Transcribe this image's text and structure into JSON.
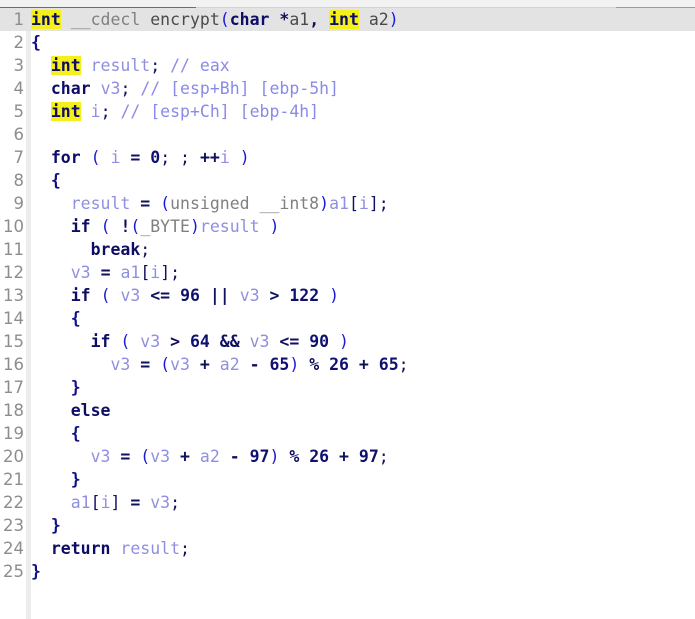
{
  "view": {
    "name": "pseudocode-view",
    "background": "#ffffff",
    "current_line_background": "#e3e3e3",
    "gutter_rule_color": "#ececec",
    "highlight_color": "#f5ef1b",
    "colors": {
      "keyword": "#0d0d66",
      "type": "#808080",
      "variable": "#8f8fe0",
      "number": "#10106e",
      "comment": "#8a8ae8",
      "paren": "#1a1ad6",
      "lineno": "#8d8d8d"
    }
  },
  "code": {
    "language": "c-pseudocode",
    "function_name": "encrypt",
    "total_lines": 25,
    "current_line": 1,
    "lines": [
      {
        "n": "1",
        "current": true,
        "tokens": [
          {
            "t": "int",
            "c": "kwhl"
          },
          {
            "t": " ",
            "c": "punct"
          },
          {
            "t": "__cdecl",
            "c": "type"
          },
          {
            "t": " ",
            "c": "punct"
          },
          {
            "t": "encrypt",
            "c": "func"
          },
          {
            "t": "(",
            "c": "paren"
          },
          {
            "t": "char",
            "c": "kw"
          },
          {
            "t": " *",
            "c": "op"
          },
          {
            "t": "a1",
            "c": "func"
          },
          {
            "t": ", ",
            "c": "op"
          },
          {
            "t": "int",
            "c": "kwhl"
          },
          {
            "t": " ",
            "c": "punct"
          },
          {
            "t": "a2",
            "c": "func"
          },
          {
            "t": ")",
            "c": "paren"
          }
        ]
      },
      {
        "n": "2",
        "current": false,
        "tokens": [
          {
            "t": "{",
            "c": "brace"
          }
        ]
      },
      {
        "n": "3",
        "current": false,
        "tokens": [
          {
            "t": "  ",
            "c": "punct"
          },
          {
            "t": "int",
            "c": "kwhl"
          },
          {
            "t": " ",
            "c": "punct"
          },
          {
            "t": "result",
            "c": "var"
          },
          {
            "t": "; ",
            "c": "punct"
          },
          {
            "t": "// eax",
            "c": "cmt"
          }
        ]
      },
      {
        "n": "4",
        "current": false,
        "tokens": [
          {
            "t": "  ",
            "c": "punct"
          },
          {
            "t": "char",
            "c": "kw"
          },
          {
            "t": " ",
            "c": "punct"
          },
          {
            "t": "v3",
            "c": "var"
          },
          {
            "t": "; ",
            "c": "punct"
          },
          {
            "t": "// [esp+Bh] [ebp-5h]",
            "c": "cmt"
          }
        ]
      },
      {
        "n": "5",
        "current": false,
        "tokens": [
          {
            "t": "  ",
            "c": "punct"
          },
          {
            "t": "int",
            "c": "kwhl"
          },
          {
            "t": " ",
            "c": "punct"
          },
          {
            "t": "i",
            "c": "var"
          },
          {
            "t": "; ",
            "c": "punct"
          },
          {
            "t": "// [esp+Ch] [ebp-4h]",
            "c": "cmt"
          }
        ]
      },
      {
        "n": "6",
        "current": false,
        "tokens": []
      },
      {
        "n": "7",
        "current": false,
        "tokens": [
          {
            "t": "  ",
            "c": "punct"
          },
          {
            "t": "for",
            "c": "kw"
          },
          {
            "t": " ",
            "c": "punct"
          },
          {
            "t": "(",
            "c": "paren"
          },
          {
            "t": " ",
            "c": "punct"
          },
          {
            "t": "i",
            "c": "var"
          },
          {
            "t": " ",
            "c": "punct"
          },
          {
            "t": "=",
            "c": "op"
          },
          {
            "t": " ",
            "c": "punct"
          },
          {
            "t": "0",
            "c": "num"
          },
          {
            "t": "; ; ",
            "c": "punct"
          },
          {
            "t": "++",
            "c": "op"
          },
          {
            "t": "i",
            "c": "var"
          },
          {
            "t": " ",
            "c": "punct"
          },
          {
            "t": ")",
            "c": "paren"
          }
        ]
      },
      {
        "n": "8",
        "current": false,
        "tokens": [
          {
            "t": "  ",
            "c": "punct"
          },
          {
            "t": "{",
            "c": "brace"
          }
        ]
      },
      {
        "n": "9",
        "current": false,
        "tokens": [
          {
            "t": "    ",
            "c": "punct"
          },
          {
            "t": "result",
            "c": "var"
          },
          {
            "t": " ",
            "c": "punct"
          },
          {
            "t": "=",
            "c": "op"
          },
          {
            "t": " ",
            "c": "punct"
          },
          {
            "t": "(",
            "c": "paren"
          },
          {
            "t": "unsigned __int8",
            "c": "type"
          },
          {
            "t": ")",
            "c": "paren"
          },
          {
            "t": "a1",
            "c": "var"
          },
          {
            "t": "[",
            "c": "punct"
          },
          {
            "t": "i",
            "c": "var"
          },
          {
            "t": "];",
            "c": "punct"
          }
        ]
      },
      {
        "n": "10",
        "current": false,
        "tokens": [
          {
            "t": "    ",
            "c": "punct"
          },
          {
            "t": "if",
            "c": "kw"
          },
          {
            "t": " ",
            "c": "punct"
          },
          {
            "t": "(",
            "c": "paren"
          },
          {
            "t": " ",
            "c": "punct"
          },
          {
            "t": "!",
            "c": "op"
          },
          {
            "t": "(",
            "c": "paren"
          },
          {
            "t": "_BYTE",
            "c": "type"
          },
          {
            "t": ")",
            "c": "paren"
          },
          {
            "t": "result",
            "c": "var"
          },
          {
            "t": " ",
            "c": "punct"
          },
          {
            "t": ")",
            "c": "paren"
          }
        ]
      },
      {
        "n": "11",
        "current": false,
        "tokens": [
          {
            "t": "      ",
            "c": "punct"
          },
          {
            "t": "break",
            "c": "kw"
          },
          {
            "t": ";",
            "c": "punct"
          }
        ]
      },
      {
        "n": "12",
        "current": false,
        "tokens": [
          {
            "t": "    ",
            "c": "punct"
          },
          {
            "t": "v3",
            "c": "var"
          },
          {
            "t": " ",
            "c": "punct"
          },
          {
            "t": "=",
            "c": "op"
          },
          {
            "t": " ",
            "c": "punct"
          },
          {
            "t": "a1",
            "c": "var"
          },
          {
            "t": "[",
            "c": "punct"
          },
          {
            "t": "i",
            "c": "var"
          },
          {
            "t": "];",
            "c": "punct"
          }
        ]
      },
      {
        "n": "13",
        "current": false,
        "tokens": [
          {
            "t": "    ",
            "c": "punct"
          },
          {
            "t": "if",
            "c": "kw"
          },
          {
            "t": " ",
            "c": "punct"
          },
          {
            "t": "(",
            "c": "paren"
          },
          {
            "t": " ",
            "c": "punct"
          },
          {
            "t": "v3",
            "c": "var"
          },
          {
            "t": " ",
            "c": "punct"
          },
          {
            "t": "<=",
            "c": "op"
          },
          {
            "t": " ",
            "c": "punct"
          },
          {
            "t": "96",
            "c": "num"
          },
          {
            "t": " ",
            "c": "punct"
          },
          {
            "t": "||",
            "c": "op"
          },
          {
            "t": " ",
            "c": "punct"
          },
          {
            "t": "v3",
            "c": "var"
          },
          {
            "t": " ",
            "c": "punct"
          },
          {
            "t": ">",
            "c": "op"
          },
          {
            "t": " ",
            "c": "punct"
          },
          {
            "t": "122",
            "c": "num"
          },
          {
            "t": " ",
            "c": "punct"
          },
          {
            "t": ")",
            "c": "paren"
          }
        ]
      },
      {
        "n": "14",
        "current": false,
        "tokens": [
          {
            "t": "    ",
            "c": "punct"
          },
          {
            "t": "{",
            "c": "brace"
          }
        ]
      },
      {
        "n": "15",
        "current": false,
        "tokens": [
          {
            "t": "      ",
            "c": "punct"
          },
          {
            "t": "if",
            "c": "kw"
          },
          {
            "t": " ",
            "c": "punct"
          },
          {
            "t": "(",
            "c": "paren"
          },
          {
            "t": " ",
            "c": "punct"
          },
          {
            "t": "v3",
            "c": "var"
          },
          {
            "t": " ",
            "c": "punct"
          },
          {
            "t": ">",
            "c": "op"
          },
          {
            "t": " ",
            "c": "punct"
          },
          {
            "t": "64",
            "c": "num"
          },
          {
            "t": " ",
            "c": "punct"
          },
          {
            "t": "&&",
            "c": "op"
          },
          {
            "t": " ",
            "c": "punct"
          },
          {
            "t": "v3",
            "c": "var"
          },
          {
            "t": " ",
            "c": "punct"
          },
          {
            "t": "<=",
            "c": "op"
          },
          {
            "t": " ",
            "c": "punct"
          },
          {
            "t": "90",
            "c": "num"
          },
          {
            "t": " ",
            "c": "punct"
          },
          {
            "t": ")",
            "c": "paren"
          }
        ]
      },
      {
        "n": "16",
        "current": false,
        "tokens": [
          {
            "t": "        ",
            "c": "punct"
          },
          {
            "t": "v3",
            "c": "var"
          },
          {
            "t": " ",
            "c": "punct"
          },
          {
            "t": "=",
            "c": "op"
          },
          {
            "t": " ",
            "c": "punct"
          },
          {
            "t": "(",
            "c": "paren"
          },
          {
            "t": "v3",
            "c": "var"
          },
          {
            "t": " ",
            "c": "punct"
          },
          {
            "t": "+",
            "c": "op"
          },
          {
            "t": " ",
            "c": "punct"
          },
          {
            "t": "a2",
            "c": "var"
          },
          {
            "t": " ",
            "c": "punct"
          },
          {
            "t": "-",
            "c": "op"
          },
          {
            "t": " ",
            "c": "punct"
          },
          {
            "t": "65",
            "c": "num"
          },
          {
            "t": ")",
            "c": "paren"
          },
          {
            "t": " ",
            "c": "punct"
          },
          {
            "t": "%",
            "c": "op"
          },
          {
            "t": " ",
            "c": "punct"
          },
          {
            "t": "26",
            "c": "num"
          },
          {
            "t": " ",
            "c": "punct"
          },
          {
            "t": "+",
            "c": "op"
          },
          {
            "t": " ",
            "c": "punct"
          },
          {
            "t": "65",
            "c": "num"
          },
          {
            "t": ";",
            "c": "punct"
          }
        ]
      },
      {
        "n": "17",
        "current": false,
        "tokens": [
          {
            "t": "    ",
            "c": "punct"
          },
          {
            "t": "}",
            "c": "brace"
          }
        ]
      },
      {
        "n": "18",
        "current": false,
        "tokens": [
          {
            "t": "    ",
            "c": "punct"
          },
          {
            "t": "else",
            "c": "kw"
          }
        ]
      },
      {
        "n": "19",
        "current": false,
        "tokens": [
          {
            "t": "    ",
            "c": "punct"
          },
          {
            "t": "{",
            "c": "brace"
          }
        ]
      },
      {
        "n": "20",
        "current": false,
        "tokens": [
          {
            "t": "      ",
            "c": "punct"
          },
          {
            "t": "v3",
            "c": "var"
          },
          {
            "t": " ",
            "c": "punct"
          },
          {
            "t": "=",
            "c": "op"
          },
          {
            "t": " ",
            "c": "punct"
          },
          {
            "t": "(",
            "c": "paren"
          },
          {
            "t": "v3",
            "c": "var"
          },
          {
            "t": " ",
            "c": "punct"
          },
          {
            "t": "+",
            "c": "op"
          },
          {
            "t": " ",
            "c": "punct"
          },
          {
            "t": "a2",
            "c": "var"
          },
          {
            "t": " ",
            "c": "punct"
          },
          {
            "t": "-",
            "c": "op"
          },
          {
            "t": " ",
            "c": "punct"
          },
          {
            "t": "97",
            "c": "num"
          },
          {
            "t": ")",
            "c": "paren"
          },
          {
            "t": " ",
            "c": "punct"
          },
          {
            "t": "%",
            "c": "op"
          },
          {
            "t": " ",
            "c": "punct"
          },
          {
            "t": "26",
            "c": "num"
          },
          {
            "t": " ",
            "c": "punct"
          },
          {
            "t": "+",
            "c": "op"
          },
          {
            "t": " ",
            "c": "punct"
          },
          {
            "t": "97",
            "c": "num"
          },
          {
            "t": ";",
            "c": "punct"
          }
        ]
      },
      {
        "n": "21",
        "current": false,
        "tokens": [
          {
            "t": "    ",
            "c": "punct"
          },
          {
            "t": "}",
            "c": "brace"
          }
        ]
      },
      {
        "n": "22",
        "current": false,
        "tokens": [
          {
            "t": "    ",
            "c": "punct"
          },
          {
            "t": "a1",
            "c": "var"
          },
          {
            "t": "[",
            "c": "punct"
          },
          {
            "t": "i",
            "c": "var"
          },
          {
            "t": "]",
            "c": "punct"
          },
          {
            "t": " ",
            "c": "punct"
          },
          {
            "t": "=",
            "c": "op"
          },
          {
            "t": " ",
            "c": "punct"
          },
          {
            "t": "v3",
            "c": "var"
          },
          {
            "t": ";",
            "c": "punct"
          }
        ]
      },
      {
        "n": "23",
        "current": false,
        "tokens": [
          {
            "t": "  ",
            "c": "punct"
          },
          {
            "t": "}",
            "c": "brace"
          }
        ]
      },
      {
        "n": "24",
        "current": false,
        "tokens": [
          {
            "t": "  ",
            "c": "punct"
          },
          {
            "t": "return",
            "c": "kw"
          },
          {
            "t": " ",
            "c": "punct"
          },
          {
            "t": "result",
            "c": "var"
          },
          {
            "t": ";",
            "c": "punct"
          }
        ]
      },
      {
        "n": "25",
        "current": false,
        "tokens": [
          {
            "t": "}",
            "c": "brace"
          }
        ]
      }
    ],
    "plain_text": [
      "int __cdecl encrypt(char *a1, int a2)",
      "{",
      "  int result; // eax",
      "  char v3; // [esp+Bh] [ebp-5h]",
      "  int i; // [esp+Ch] [ebp-4h]",
      "",
      "  for ( i = 0; ; ++i )",
      "  {",
      "    result = (unsigned __int8)a1[i];",
      "    if ( !(_BYTE)result )",
      "      break;",
      "    v3 = a1[i];",
      "    if ( v3 <= 96 || v3 > 122 )",
      "    {",
      "      if ( v3 > 64 && v3 <= 90 )",
      "        v3 = (v3 + a2 - 65) % 26 + 65;",
      "    }",
      "    else",
      "    {",
      "      v3 = (v3 + a2 - 97) % 26 + 97;",
      "    }",
      "    a1[i] = v3;",
      "  }",
      "  return result;",
      "}"
    ]
  }
}
